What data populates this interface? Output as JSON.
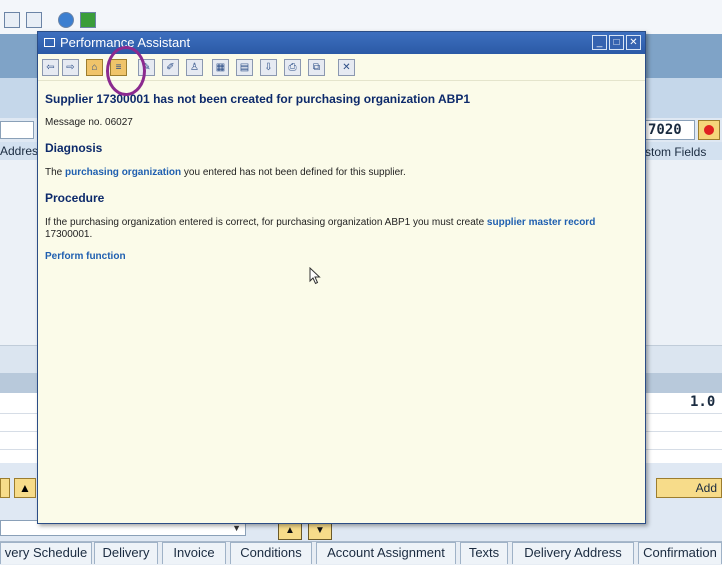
{
  "background": {
    "year_value": "7020",
    "address_tab_partial": "Addres",
    "custom_fields_partial": "stom Fields",
    "value_partial": "1.0",
    "add_button_partial": "Add",
    "tabs": [
      "very Schedule",
      "Delivery",
      "Invoice",
      "Conditions",
      "Account Assignment",
      "Texts",
      "Delivery Address",
      "Confirmation"
    ]
  },
  "dialog": {
    "title": "Performance Assistant",
    "heading": "Supplier 17300001 has not been created for purchasing organization ABP1",
    "message_no": "Message no. 06027",
    "diagnosis_heading": "Diagnosis",
    "diagnosis_prefix": "The ",
    "diagnosis_link": "purchasing organization",
    "diagnosis_suffix": " you entered has not been defined for this supplier.",
    "procedure_heading": "Procedure",
    "procedure_prefix": "If the purchasing organization entered is correct, for purchasing organization ABP1 you must create ",
    "procedure_link": "supplier master record",
    "procedure_suffix": "17300001.",
    "perform_function": "Perform function"
  },
  "colors": {
    "annotation_circle": "#8b2a8f",
    "title_bar": "#2b5aa6",
    "dialog_bg": "#fbfbe9",
    "link": "#1f5fb0"
  }
}
